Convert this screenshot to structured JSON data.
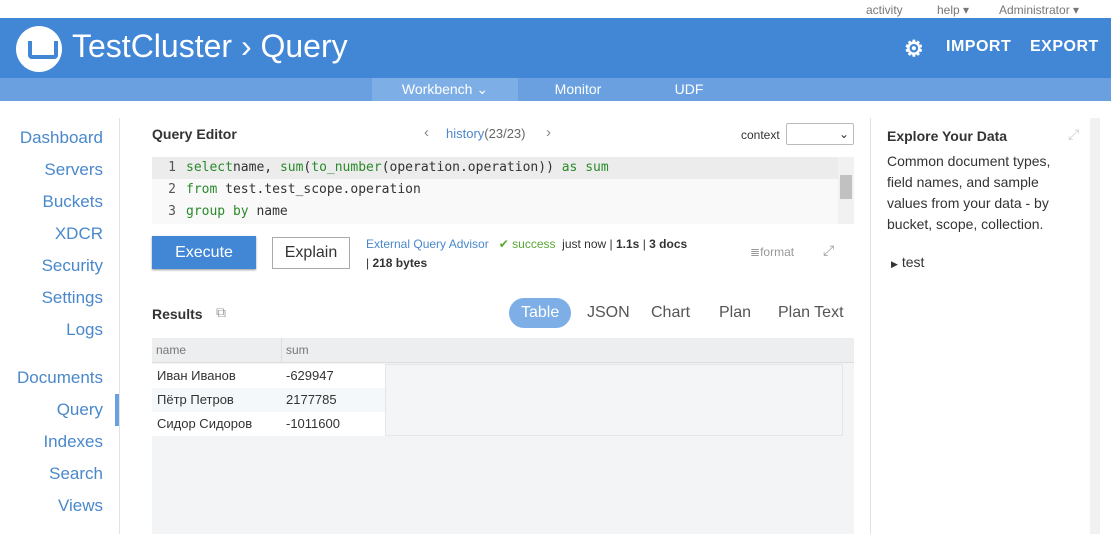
{
  "top_links": {
    "activity": "activity",
    "help": "help ▾",
    "admin": "Administrator ▾"
  },
  "header": {
    "title": "TestCluster › Query",
    "import": "IMPORT",
    "export": "EXPORT",
    "settings_icon": "gear-icon",
    "accent": "#4287d6"
  },
  "subnav": {
    "tabs": [
      {
        "label": "Workbench ⌄",
        "active": true
      },
      {
        "label": "Monitor"
      },
      {
        "label": "UDF"
      }
    ]
  },
  "sidebar": {
    "items": [
      "Dashboard",
      "Servers",
      "Buckets",
      "XDCR",
      "Security",
      "Settings",
      "Logs",
      "Documents",
      "Query",
      "Indexes",
      "Search",
      "Views"
    ],
    "active": "Query"
  },
  "editor": {
    "title": "Query Editor",
    "history": "history",
    "history_count": "(23/23)",
    "context_label": "context",
    "context_value": "",
    "lines": [
      {
        "n": "1",
        "parts": [
          [
            "kw",
            "select"
          ],
          [
            "",
            "name, "
          ],
          [
            "kw",
            "sum"
          ],
          [
            "",
            "("
          ],
          [
            "kw",
            "to_number"
          ],
          [
            "",
            "(operation.operation)) "
          ],
          [
            "kw",
            "as"
          ],
          [
            "",
            " "
          ],
          [
            "kw",
            "sum"
          ]
        ]
      },
      {
        "n": "2",
        "parts": [
          [
            "kw",
            "from"
          ],
          [
            "",
            " test.test_scope.operation"
          ]
        ]
      },
      {
        "n": "3",
        "parts": [
          [
            "kw",
            "group by"
          ],
          [
            "",
            " name"
          ]
        ]
      }
    ]
  },
  "actions": {
    "execute": "Execute",
    "explain": "Explain",
    "advisor": "External Query Advisor",
    "status": "success",
    "when": "just now",
    "time": "1.1s",
    "docs": "3 docs",
    "size": "218 bytes",
    "format": "format"
  },
  "results": {
    "title": "Results",
    "tabs": [
      "Table",
      "JSON",
      "Chart",
      "Plan",
      "Plan Text"
    ],
    "active_tab": "Table",
    "columns": [
      "name",
      "sum"
    ],
    "rows": [
      [
        "Иван Иванов",
        "-629947"
      ],
      [
        "Пётр Петров",
        "2177785"
      ],
      [
        "Сидор Сидоров",
        "-1011600"
      ]
    ]
  },
  "explore": {
    "title": "Explore Your Data",
    "desc": "Common document types, field names, and sample values from your data - by bucket, scope, collection.",
    "tree": [
      "test"
    ]
  }
}
